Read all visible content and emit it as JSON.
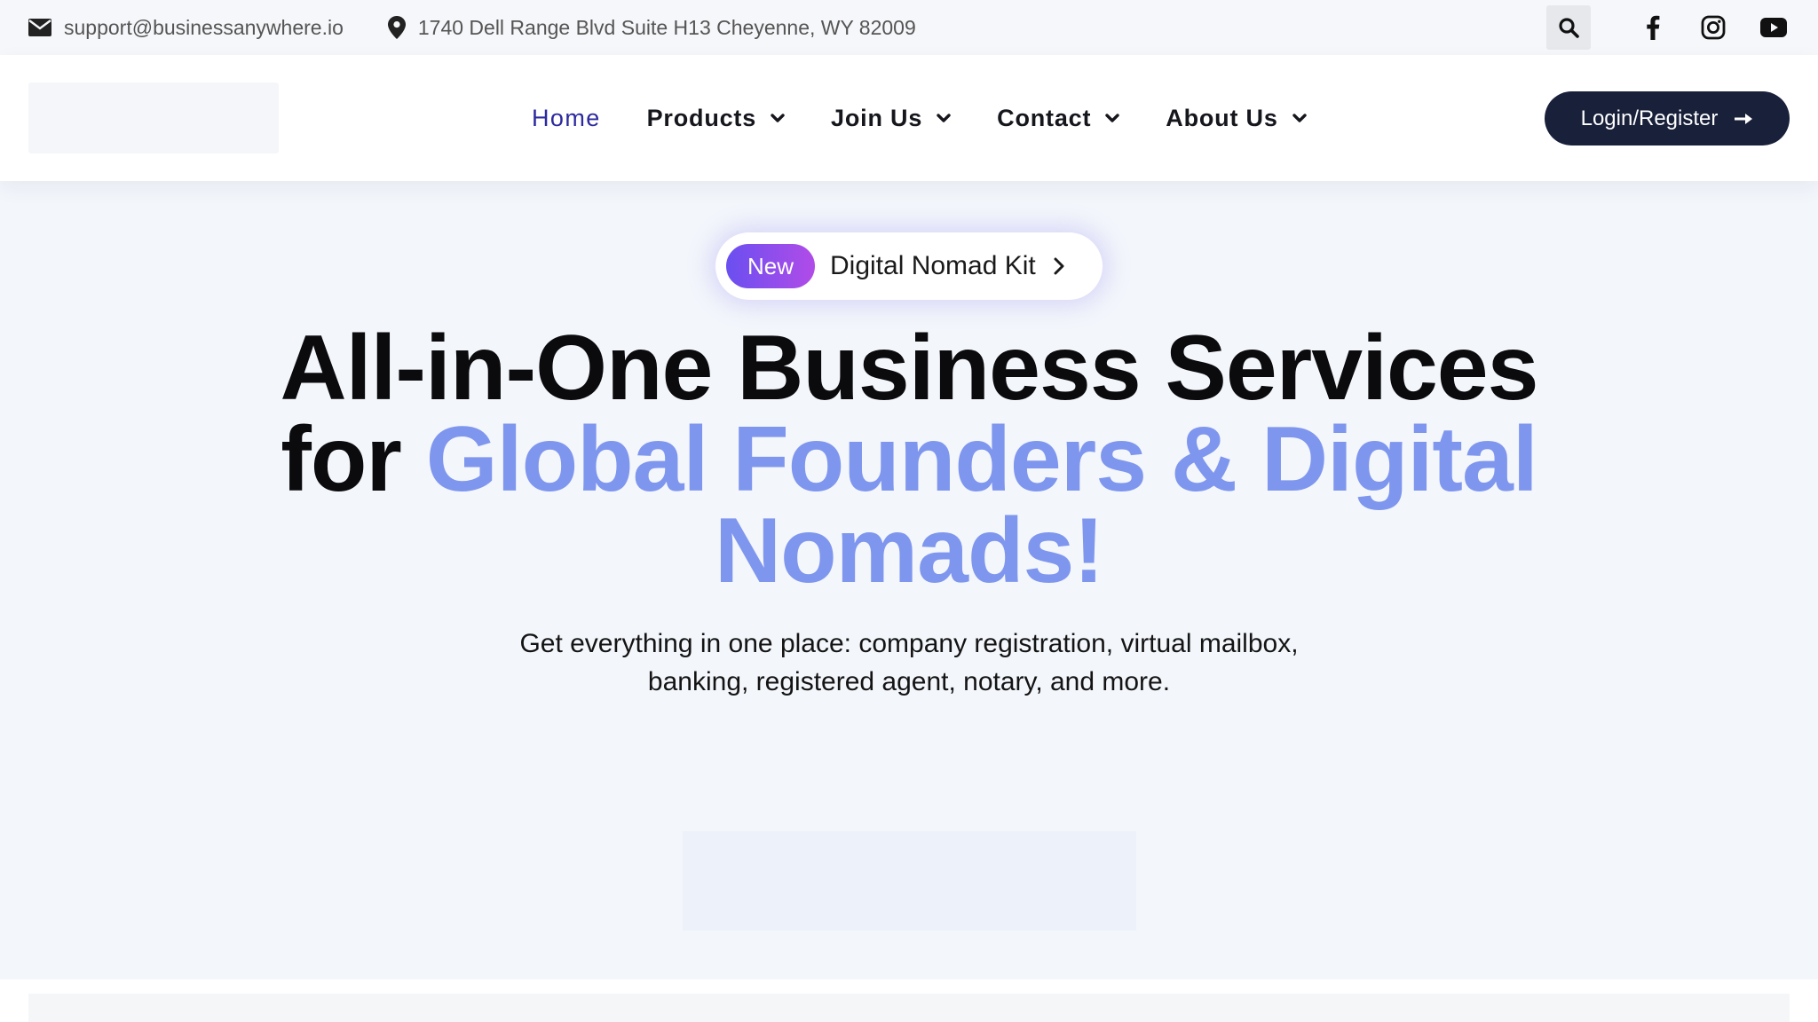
{
  "topbar": {
    "email": "support@businessanywhere.io",
    "address": "1740 Dell Range Blvd Suite H13 Cheyenne, WY 82009",
    "icons": [
      "envelope-icon",
      "map-pin-icon",
      "search-icon",
      "facebook-icon",
      "instagram-icon",
      "youtube-icon"
    ]
  },
  "nav": {
    "items": [
      {
        "label": "Home",
        "active": true
      },
      {
        "label": "Products",
        "dropdown": true
      },
      {
        "label": "Join Us",
        "dropdown": true
      },
      {
        "label": "Contact",
        "dropdown": true
      },
      {
        "label": "About Us",
        "dropdown": true
      }
    ],
    "login_label": "Login/Register"
  },
  "hero": {
    "badge_tag": "New",
    "badge_text": "Digital Nomad Kit",
    "headline_line1": "All-in-One Business Services",
    "headline_for": "for ",
    "headline_highlight_a": "Global Founders & Digital",
    "headline_highlight_b": "Nomads!",
    "subtext_line1": "Get everything in one place: company registration, virtual mailbox,",
    "subtext_line2": "banking, registered agent, notary, and more."
  },
  "colors": {
    "accent": "#7f96ee",
    "nav_active": "#2d2a9e",
    "button_dark": "#18203a",
    "badge_gradient_start": "#6a4ff0",
    "badge_gradient_end": "#b14ce8"
  }
}
